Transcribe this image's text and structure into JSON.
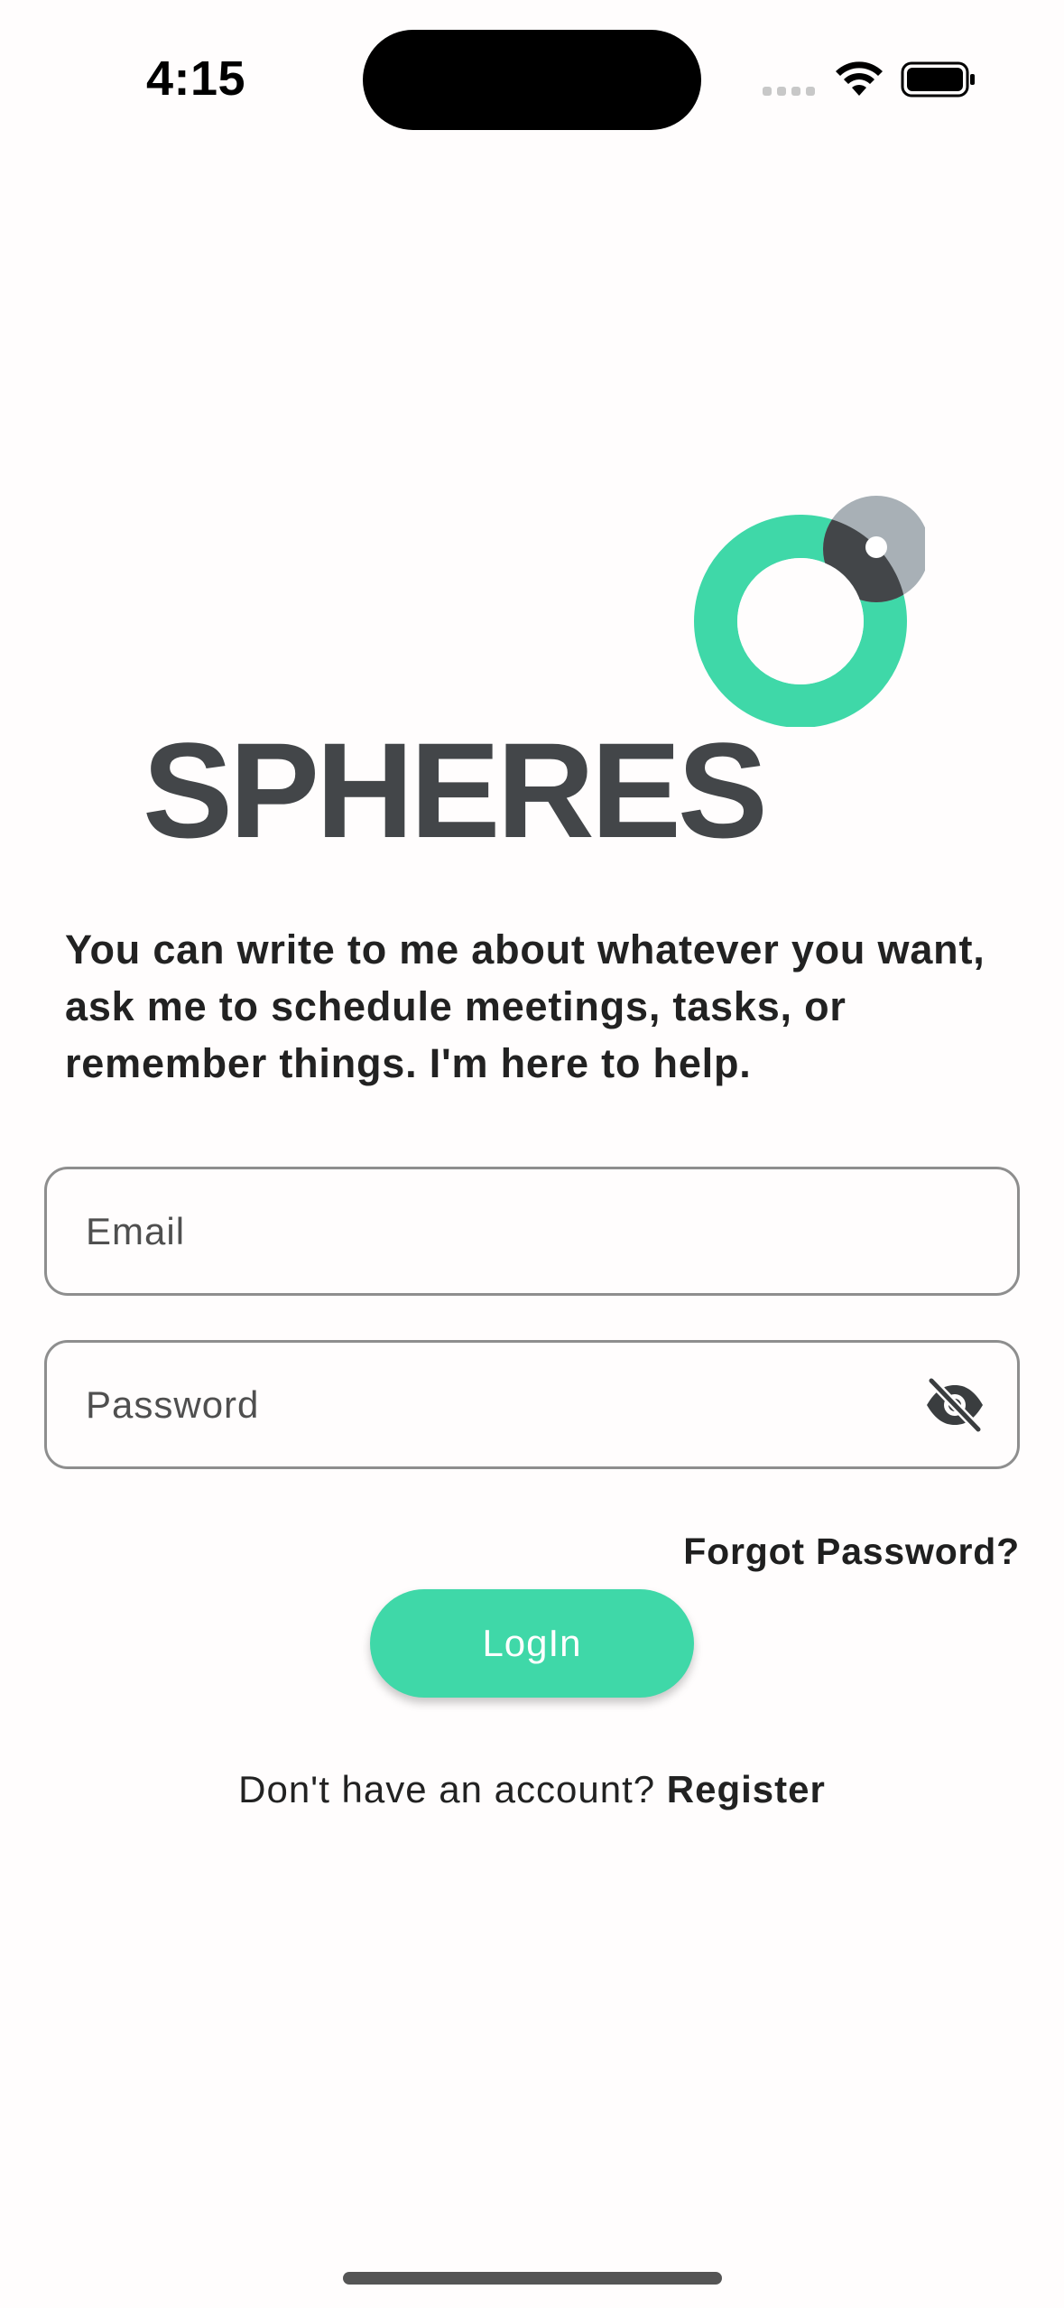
{
  "status_bar": {
    "time": "4:15"
  },
  "logo": {
    "wordmark": "SPHERES",
    "colors": {
      "ring": "#3fd8a8",
      "text": "#434649",
      "dot_light": "#a8b0b6",
      "dot_dark": "#434649"
    }
  },
  "intro_text": "You can write to me about whatever you want, ask me to schedule meetings, tasks, or remember things. I'm here to help.",
  "form": {
    "email_placeholder": "Email",
    "email_value": "",
    "password_placeholder": "Password",
    "password_value": "",
    "visibility_icon": "eye-off-icon"
  },
  "forgot_password_label": "Forgot Password?",
  "login_label": "LogIn",
  "register": {
    "prompt": "Don't have an account?",
    "link_label": "Register"
  },
  "colors": {
    "accent": "#3fd8a8",
    "background": "#fffdfd"
  }
}
